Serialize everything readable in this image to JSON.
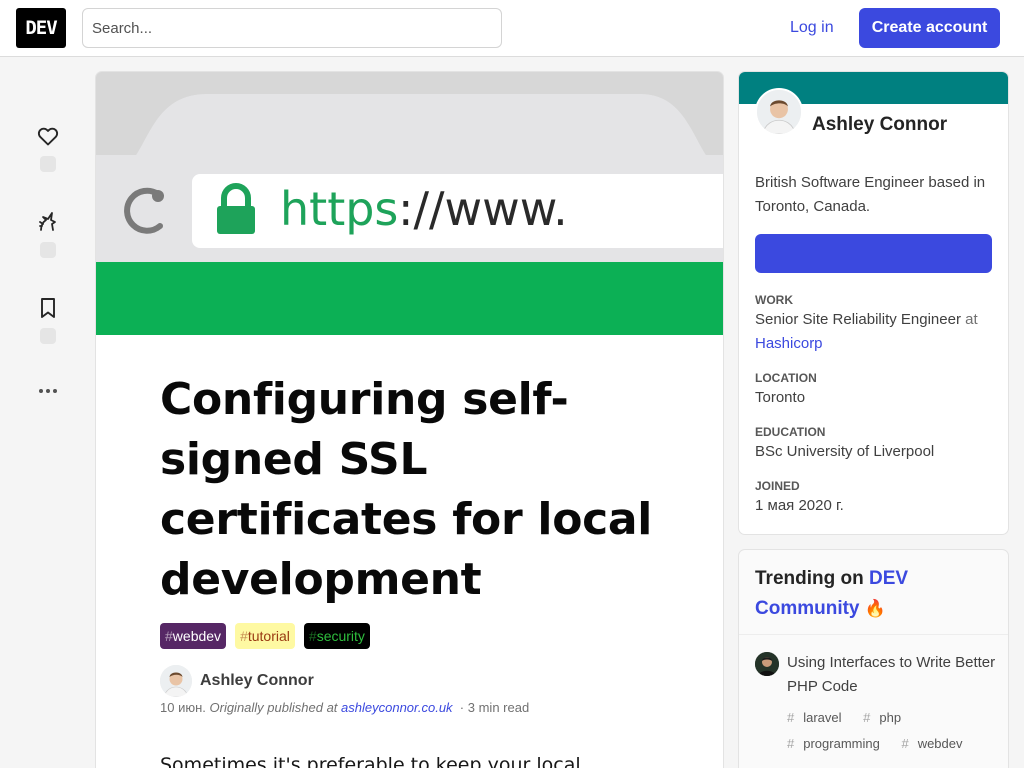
{
  "header": {
    "logo_text": "DEV",
    "search_placeholder": "Search...",
    "login_label": "Log in",
    "create_account_label": "Create account"
  },
  "reactions": {
    "icons": [
      "heart-icon",
      "unicorn-icon",
      "bookmark-icon",
      "more-horizontal-icon"
    ],
    "more_label": "···"
  },
  "article": {
    "cover_url_text_https": "https",
    "cover_url_text_rest": "://www.",
    "title": "Configuring self-signed SSL certificates for local development",
    "tags": [
      {
        "hash": "#",
        "name": "webdev",
        "bg": "#562765",
        "fg": "#ffffff"
      },
      {
        "hash": "#",
        "name": "tutorial",
        "bg": "#fef9a2",
        "fg": "#9a3a12"
      },
      {
        "hash": "#",
        "name": "security",
        "bg": "#000000",
        "fg": "#2ebd3d"
      }
    ],
    "author": "Ashley Connor",
    "date": "10 июн.",
    "originally_published": "Originally published at",
    "source_link": "ashleyconnor.co.uk",
    "separator": "·",
    "read_time": "3 min read",
    "body_start": "Sometimes it's preferable to keep your local"
  },
  "profile": {
    "name": "Ashley Connor",
    "bio": "British Software Engineer based in Toronto, Canada.",
    "follow_label": "",
    "work_label": "Work",
    "work_value": "Senior Site Reliability Engineer",
    "work_at": "at",
    "work_company": "Hashicorp",
    "location_label": "Location",
    "location_value": "Toronto",
    "education_label": "Education",
    "education_value": "BSc University of Liverpool",
    "joined_label": "Joined",
    "joined_value": "1 мая 2020 г.",
    "band_color": "#008080"
  },
  "trending": {
    "heading_prefix": "Trending on",
    "heading_dev": "DEV Community",
    "heading_emoji": "🔥",
    "item_title": "Using Interfaces to Write Better PHP Code",
    "item_tags": [
      "laravel",
      "php",
      "programming",
      "webdev"
    ]
  },
  "colors": {
    "accent": "#3b49df",
    "lock_green": "#1ea35a",
    "banner_green": "#0cb055"
  }
}
